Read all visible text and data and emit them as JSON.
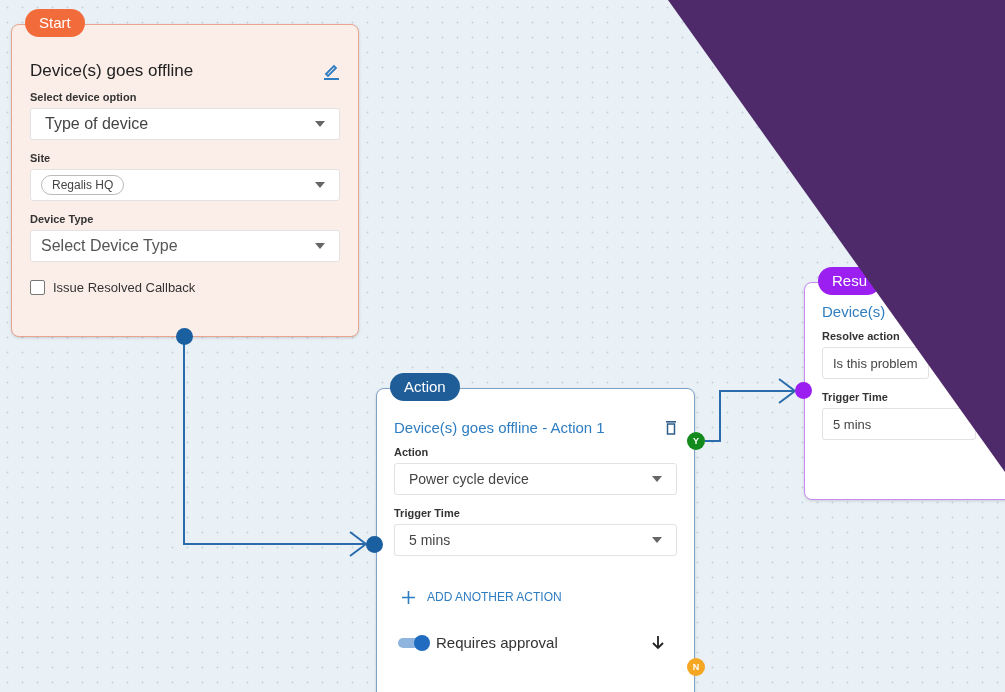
{
  "nodes": [
    {
      "kind": "start",
      "badge": "Start",
      "color": "#f26b3a",
      "title": "Device(s) goes offline",
      "fields": [
        {
          "kind": "select",
          "label": "Select device option",
          "value": "Type of device"
        },
        {
          "kind": "chip",
          "label": "Site",
          "chip": "Regalis HQ"
        },
        {
          "kind": "select",
          "label": "Device Type",
          "placeholder": "Select Device Type"
        }
      ],
      "checkbox": {
        "label": "Issue Resolved Callback",
        "checked": false
      }
    },
    {
      "kind": "action",
      "badge": "Action",
      "color": "#1f5d99",
      "title": "Device(s) goes offline - Action 1",
      "fields": [
        {
          "kind": "select",
          "label": "Action",
          "value": "Power cycle device"
        },
        {
          "kind": "select",
          "label": "Trigger Time",
          "value": "5 mins"
        }
      ],
      "add_button": "ADD ANOTHER ACTION",
      "toggle": {
        "label": "Requires approval",
        "on": true
      },
      "yes_port": "Y",
      "no_port": "N"
    },
    {
      "kind": "resolve",
      "badge": "Resu",
      "color": "#9b1ff0",
      "title": "Device(s)",
      "fields": [
        {
          "kind": "text",
          "label": "Resolve action",
          "value": "Is this problem"
        },
        {
          "kind": "text",
          "label": "Trigger Time",
          "value": "5 mins"
        }
      ]
    }
  ]
}
